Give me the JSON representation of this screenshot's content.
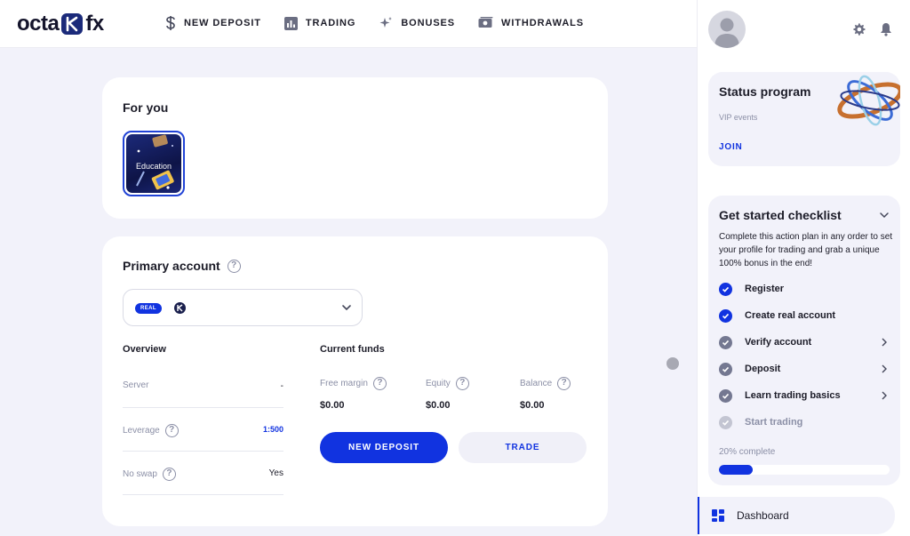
{
  "logo": {
    "left": "octa",
    "right": "fx"
  },
  "nav": [
    {
      "label": "NEW DEPOSIT",
      "icon": "dollar-icon"
    },
    {
      "label": "TRADING",
      "icon": "chart-icon"
    },
    {
      "label": "BONUSES",
      "icon": "sparkle-icon"
    },
    {
      "label": "WITHDRAWALS",
      "icon": "cash-icon"
    }
  ],
  "for_you": {
    "title": "For you",
    "tile_label": "Education"
  },
  "primary_account": {
    "title": "Primary account",
    "account_type_badge": "REAL",
    "overview": {
      "title": "Overview",
      "rows": [
        {
          "label": "Server",
          "value": "-"
        },
        {
          "label": "Leverage",
          "value": "1:500"
        },
        {
          "label": "No swap",
          "value": "Yes"
        }
      ]
    },
    "funds": {
      "title": "Current funds",
      "items": [
        {
          "label": "Free margin",
          "value": "$0.00"
        },
        {
          "label": "Equity",
          "value": "$0.00"
        },
        {
          "label": "Balance",
          "value": "$0.00"
        }
      ]
    },
    "new_deposit_label": "NEW DEPOSIT",
    "trade_label": "TRADE"
  },
  "status_program": {
    "title": "Status program",
    "subtitle": "VIP events",
    "join_label": "JOIN"
  },
  "checklist": {
    "title": "Get started checklist",
    "description": "Complete this action plan in any order to set your profile for trading and grab a unique 100% bonus in the end!",
    "steps": [
      {
        "label": "Register",
        "state": "done"
      },
      {
        "label": "Create real account",
        "state": "done"
      },
      {
        "label": "Verify account",
        "state": "pending"
      },
      {
        "label": "Deposit",
        "state": "pending"
      },
      {
        "label": "Learn trading basics",
        "state": "pending"
      },
      {
        "label": "Start trading",
        "state": "disabled"
      }
    ],
    "progress_label": "20% complete",
    "progress_fraction": 0.2
  },
  "sidebar_nav": {
    "dashboard_label": "Dashboard"
  },
  "colors": {
    "accent": "#1133e0",
    "background": "#f2f2fa"
  }
}
